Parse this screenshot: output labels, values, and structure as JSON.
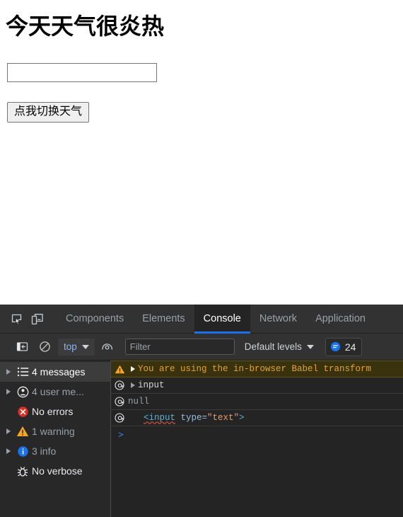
{
  "page": {
    "heading": "今天天气很炎热",
    "input_value": "",
    "input_placeholder": "",
    "button_label": "点我切换天气"
  },
  "devtools": {
    "toolbar_icons": {
      "inspect": "inspect-element-icon",
      "device": "device-toolbar-icon",
      "sidebar_toggle": "console-sidebar-toggle-icon",
      "clear_console": "clear-console-icon",
      "live_expression": "create-live-expression-icon"
    },
    "tabs": [
      {
        "label": "Components",
        "active": false
      },
      {
        "label": "Elements",
        "active": false
      },
      {
        "label": "Console",
        "active": true
      },
      {
        "label": "Network",
        "active": false
      },
      {
        "label": "Application",
        "active": false
      }
    ],
    "console_toolbar": {
      "context_value": "top",
      "filter_value": "",
      "filter_placeholder": "Filter",
      "levels_label": "Default levels",
      "issues_count": "24",
      "issues_icon": "issues-icon",
      "accent_color": "#1a73e8"
    },
    "sidebar": [
      {
        "label": "4 messages",
        "icon": "list-icon",
        "twisty": true,
        "selected": true,
        "muted": false
      },
      {
        "label": "4 user me...",
        "icon": "user-icon",
        "twisty": true,
        "selected": false,
        "muted": true
      },
      {
        "label": "No errors",
        "icon": "error-icon",
        "twisty": false,
        "selected": false,
        "muted": false
      },
      {
        "label": "1 warning",
        "icon": "warning-icon",
        "twisty": true,
        "selected": false,
        "muted": true
      },
      {
        "label": "3 info",
        "icon": "info-icon",
        "twisty": true,
        "selected": false,
        "muted": true
      },
      {
        "label": "No verbose",
        "icon": "bug-icon",
        "twisty": false,
        "selected": false,
        "muted": false
      }
    ],
    "messages": {
      "warning_text": "You are using the in-browser Babel transform",
      "row_input": "input",
      "row_null": "null",
      "row_markup_tag_open": "<input",
      "row_markup_attr": " type=",
      "row_markup_value": "\"text\"",
      "row_markup_tag_close": ">",
      "source_icon": "source-location-icon",
      "prompt_symbol": ">"
    }
  }
}
